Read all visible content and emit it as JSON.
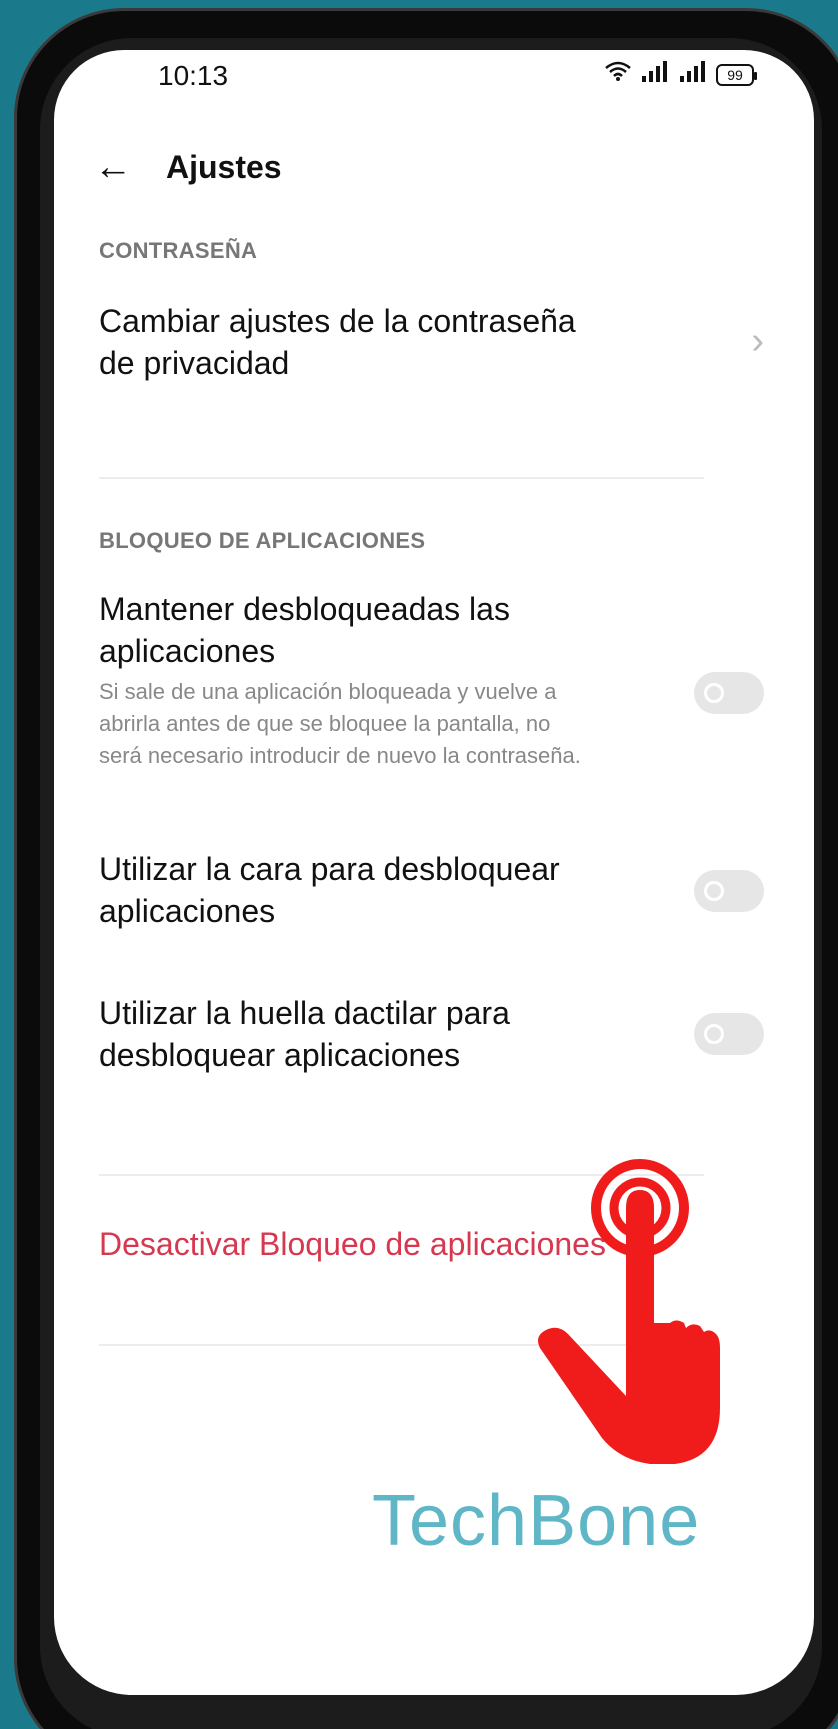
{
  "status_bar": {
    "time": "10:13",
    "battery": "99",
    "wifi_icon": "wifi-icon",
    "signal_icon": "signal-icon"
  },
  "header": {
    "title": "Ajustes",
    "back_icon": "back-arrow-icon"
  },
  "sections": {
    "password": {
      "label": "CONTRASEÑA",
      "items": [
        {
          "title": "Cambiar ajustes de la contraseña de privacidad"
        }
      ]
    },
    "app_lock": {
      "label": "BLOQUEO DE APLICACIONES",
      "items": [
        {
          "title": "Mantener desbloqueadas las aplicaciones",
          "description": "Si sale de una aplicación bloqueada y vuelve a abrirla antes de que se bloquee la pantalla, no será necesario introducir de nuevo la contraseña.",
          "enabled": false
        },
        {
          "title": "Utilizar la cara para desbloquear aplicaciones",
          "enabled": false
        },
        {
          "title": "Utilizar la huella dactilar para desbloquear aplicaciones",
          "enabled": false
        }
      ]
    }
  },
  "actions": {
    "disable_app_lock": "Desactivar Bloqueo de aplicaciones"
  },
  "watermark": "TechBone",
  "colors": {
    "accent_danger": "#d6394f",
    "background": "#1a7a8c",
    "pointer": "#f01c1c"
  }
}
